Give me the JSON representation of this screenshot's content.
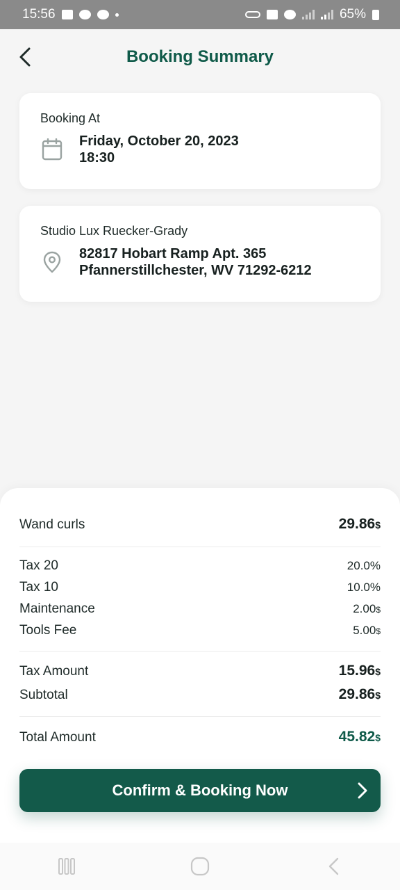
{
  "status_bar": {
    "time": "15:56",
    "battery": "65%"
  },
  "header": {
    "title": "Booking Summary",
    "back_icon": "chevron-left-icon"
  },
  "booking_card": {
    "label": "Booking At",
    "icon": "calendar-icon",
    "date": "Friday, October 20, 2023",
    "time": "18:30"
  },
  "location_card": {
    "label": "Studio Lux Ruecker-Grady",
    "icon": "location-pin-icon",
    "address_line1": "82817 Hobart Ramp Apt. 365",
    "address_line2": "Pfannerstillchester, WV 71292-6212"
  },
  "summary": {
    "service": {
      "label": "Wand curls",
      "value": "29.86",
      "currency": "$"
    },
    "fees": [
      {
        "label": "Tax 20",
        "value": "20.0%"
      },
      {
        "label": "Tax 10",
        "value": "10.0%"
      },
      {
        "label": "Maintenance",
        "value": "2.00",
        "currency": "$"
      },
      {
        "label": "Tools Fee",
        "value": "5.00",
        "currency": "$"
      }
    ],
    "tax_amount": {
      "label": "Tax Amount",
      "value": "15.96",
      "currency": "$"
    },
    "subtotal": {
      "label": "Subtotal",
      "value": "29.86",
      "currency": "$"
    },
    "total": {
      "label": "Total Amount",
      "value": "45.82",
      "currency": "$"
    }
  },
  "confirm_button": {
    "label": "Confirm & Booking Now",
    "icon": "chevron-right-icon"
  },
  "nav_bar": {
    "recents_icon": "recents-icon",
    "home_icon": "home-icon",
    "back_icon": "back-icon"
  },
  "colors": {
    "brand": "#135a4a",
    "title": "#0f5a49",
    "status_bar": "#8a8a8a",
    "background": "#f5f5f5"
  }
}
